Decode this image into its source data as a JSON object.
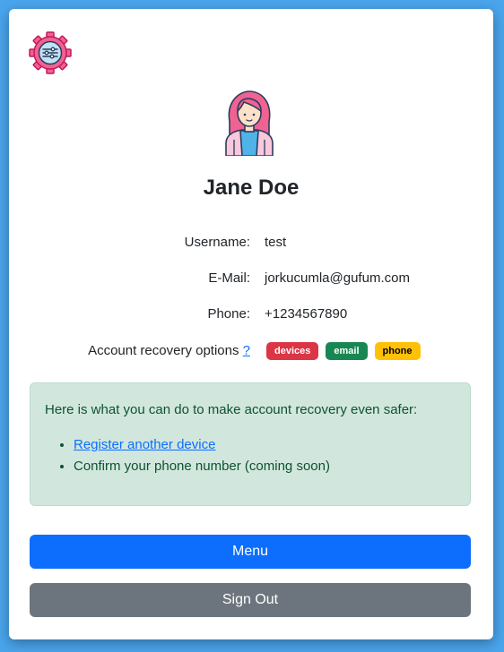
{
  "user": {
    "name": "Jane Doe",
    "username_label": "Username:",
    "username": "test",
    "email_label": "E-Mail:",
    "email": "jorkucumla@gufum.com",
    "phone_label": "Phone:",
    "phone": "+1234567890"
  },
  "recovery": {
    "label": "Account recovery options",
    "help_link": "?",
    "badges": [
      "devices",
      "email",
      "phone"
    ]
  },
  "alert": {
    "text": "Here is what you can do to make account recovery even safer:",
    "items": [
      "Register another device",
      "Confirm your phone number (coming soon)"
    ]
  },
  "buttons": {
    "menu": "Menu",
    "sign_out": "Sign Out"
  },
  "icons": {
    "settings": "gear-sliders-icon",
    "avatar": "user-avatar"
  },
  "colors": {
    "background": "#4aa5ec",
    "primary": "#0d6efd",
    "secondary": "#6c757d",
    "danger": "#dc3545",
    "success": "#198754",
    "warning": "#ffc107",
    "alert_bg": "#d1e7dd"
  }
}
